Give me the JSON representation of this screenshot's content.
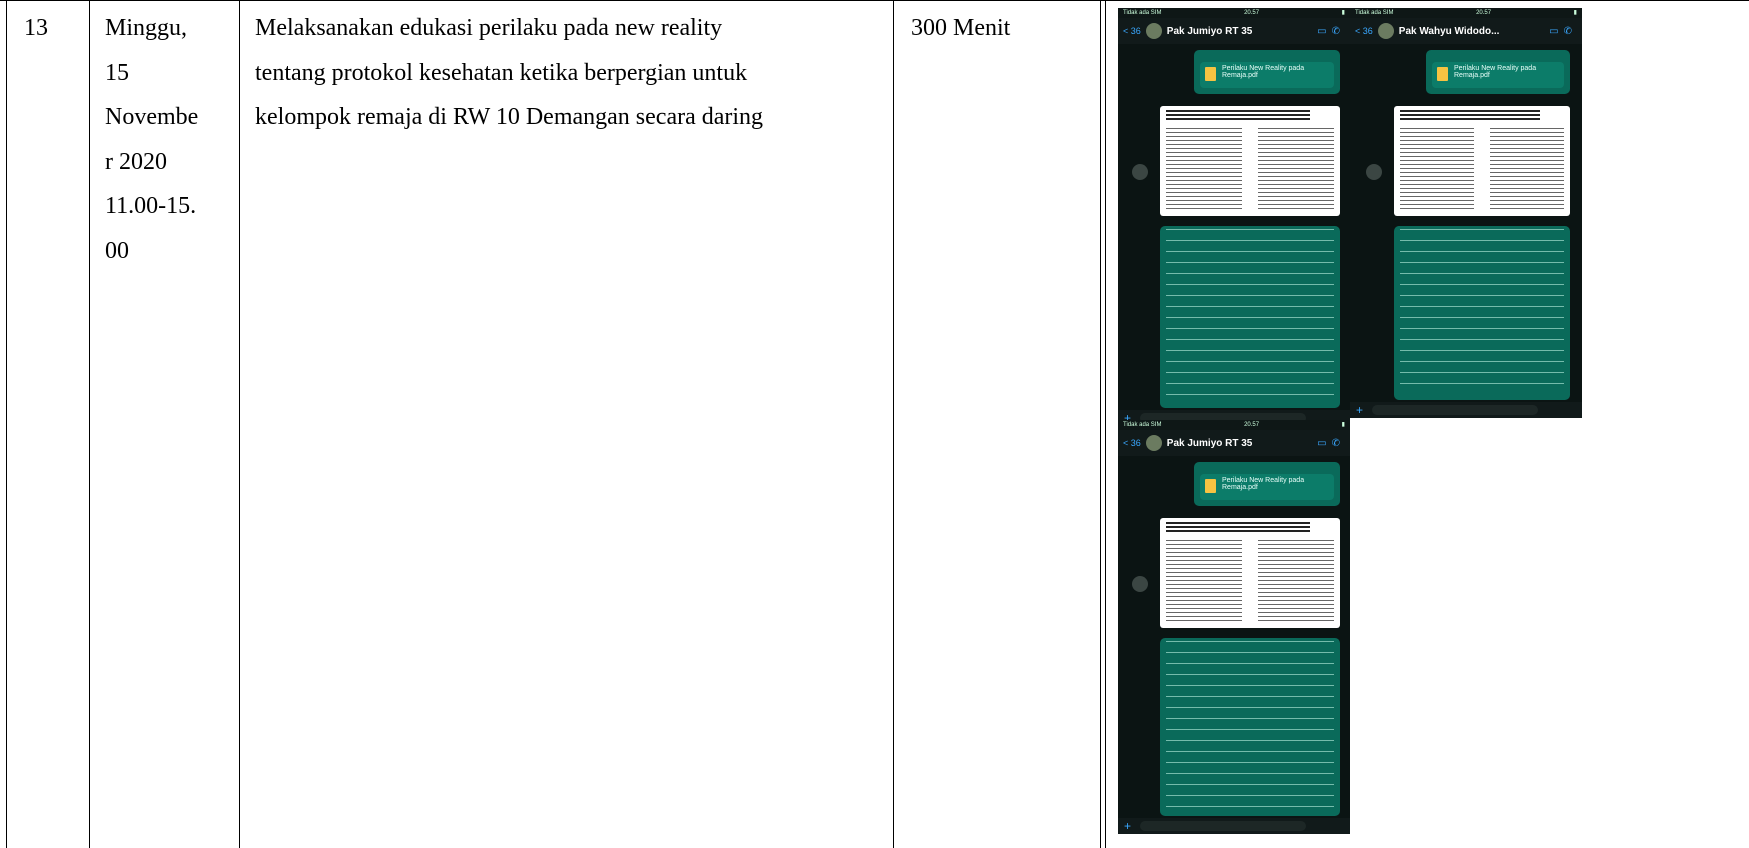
{
  "row": {
    "number": "13",
    "date_lines": [
      "Minggu,",
      "15",
      "Novembe",
      "r 2020",
      "11.00-15.",
      "00"
    ],
    "description_lines": [
      "Melaksanakan edukasi perilaku  pada new reality",
      "tentang protokol kesehatan ketika berpergian untuk",
      "kelompok remaja di RW 10 Demangan secara daring"
    ],
    "duration": "300 Menit"
  },
  "screenshots": [
    {
      "contact": "Pak Jumiyo RT 35",
      "status_left": "Tidak ada SIM",
      "time": "20.57",
      "file": "Perilaku New Reality pada Remaja.pdf",
      "back": "< 36"
    },
    {
      "contact": "Pak Wahyu Widodo...",
      "status_left": "Tidak ada SIM",
      "time": "20.57",
      "file": "Perilaku New Reality pada Remaja.pdf",
      "back": "< 36"
    },
    {
      "contact": "Pak Jumiyo RT 35",
      "status_left": "Tidak ada SIM",
      "time": "20.57",
      "file": "Perilaku New Reality pada Remaja.pdf",
      "back": "< 36"
    }
  ]
}
